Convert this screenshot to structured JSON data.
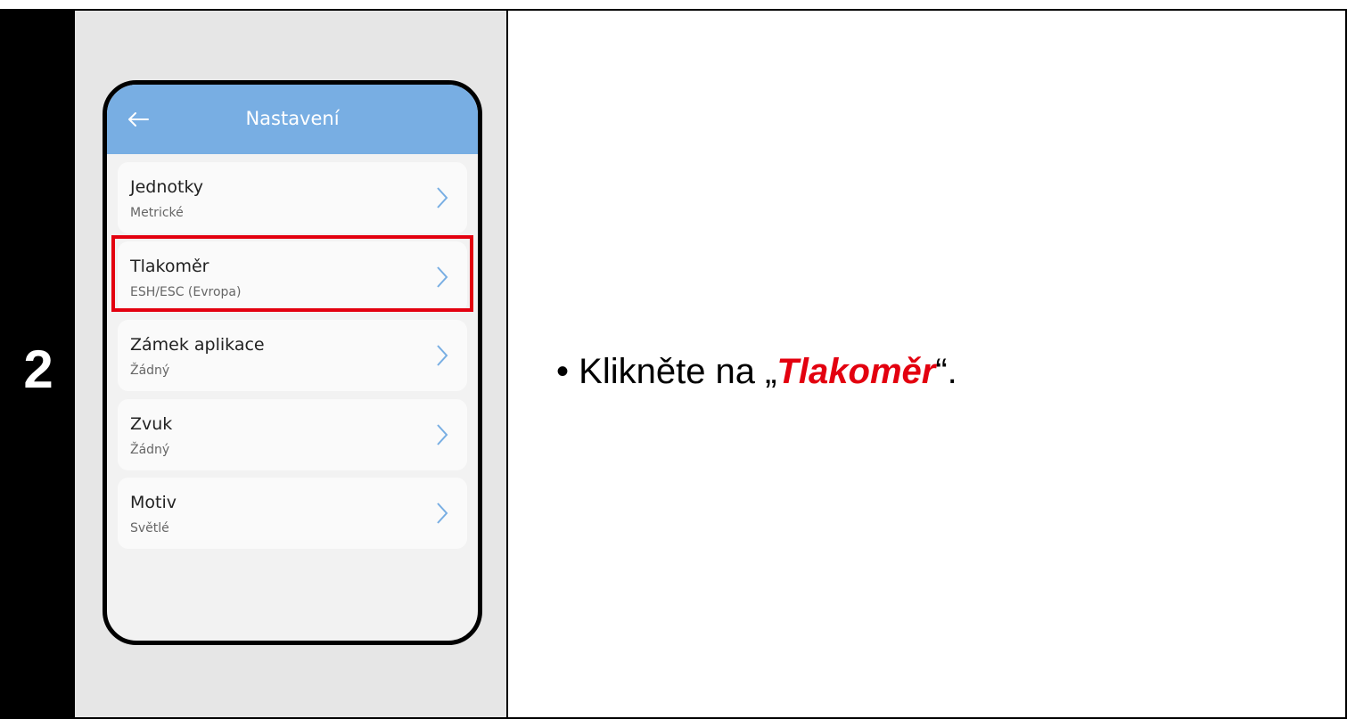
{
  "step": {
    "number": "2"
  },
  "phone": {
    "header": {
      "back_icon": "arrow-left-icon",
      "title": "Nastavení"
    },
    "items": [
      {
        "title": "Jednotky",
        "value": "Metrické",
        "icon": "chevron-right-icon"
      },
      {
        "title": "Tlakoměr",
        "value": "ESH/ESC (Evropa)",
        "icon": "chevron-right-icon"
      },
      {
        "title": "Zámek aplikace",
        "value": "Žádný",
        "icon": "chevron-right-icon"
      },
      {
        "title": "Zvuk",
        "value": "Žádný",
        "icon": "chevron-right-icon"
      },
      {
        "title": "Motiv",
        "value": "Světlé",
        "icon": "chevron-right-icon"
      }
    ]
  },
  "instruction": {
    "bullet": "•",
    "prefix": "Klikněte na „",
    "highlight": "Tlakoměr",
    "suffix": "“."
  },
  "colors": {
    "header": "#78aee3",
    "highlight": "#e3000f",
    "step_background": "#000000",
    "image_background": "#e6e6e6"
  }
}
